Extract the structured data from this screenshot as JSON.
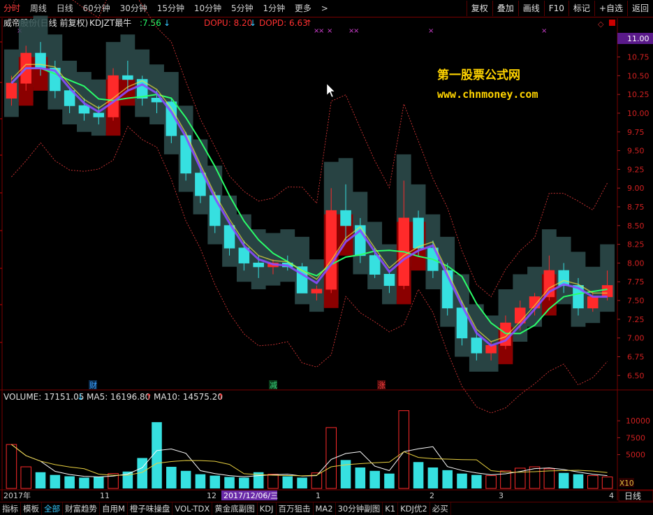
{
  "toolbar": {
    "timeframes": [
      "分时",
      "周线",
      "日线",
      "60分钟",
      "30分钟",
      "15分钟",
      "10分钟",
      "5分钟",
      "1分钟",
      "更多"
    ],
    "more_arrow": ">",
    "right_buttons": [
      "复权",
      "叠加",
      "画线",
      "F10",
      "标记",
      "+自选",
      "返回"
    ]
  },
  "main_panel": {
    "stock_title": "威帝股份(日线 前复权)",
    "indicator_name": "KDJZT最牛",
    "indicator_value": ":7.56",
    "indicator_arrow": "↓",
    "dopu_label": "DOPU: 8.20",
    "dopu_arrow": "↓",
    "dopd_label": "DOPD: 6.63",
    "dopd_arrow": "↑",
    "watermark_title": "第一股票公式网",
    "watermark_url": "www.chnmoney.com",
    "current_price_tag": "11.00",
    "price_axis": [
      "10.75",
      "10.50",
      "10.25",
      "10.00",
      "9.75",
      "9.50",
      "9.25",
      "9.00",
      "8.75",
      "8.50",
      "8.25",
      "8.00",
      "7.75",
      "7.50",
      "7.25",
      "7.00",
      "6.75",
      "6.50"
    ],
    "event_markers": [
      {
        "label": "财",
        "color": "#3aa0ff"
      },
      {
        "label": "减",
        "color": "#39d27b"
      },
      {
        "label": "涨",
        "color": "#ff4040"
      }
    ],
    "colors": {
      "up": "#ff2a2a",
      "down": "#36e0e0",
      "band": "#2f4f4f",
      "fill_red": "#8b0000",
      "ma_green": "#2aff6a",
      "purple": "#8a4dff",
      "yellow": "#e8e040",
      "dotted": "#c03030"
    }
  },
  "volume_panel": {
    "volume_label": "VOLUME: 17151.05",
    "volume_arrow": "↓",
    "ma5_label": "MA5: 16196.80",
    "ma5_arrow": "↑",
    "ma10_label": "MA10: 14575.20",
    "ma10_arrow": "↑",
    "axis": [
      "10000",
      "7500",
      "5000"
    ],
    "unit": "X10"
  },
  "date_axis": {
    "labels": [
      "2017年",
      "11",
      "12",
      "1",
      "2",
      "3",
      "4"
    ],
    "cursor_date": "2017/12/06/三",
    "period": "日线"
  },
  "bottom_tabs": [
    "指标",
    "模板",
    "全部",
    "财富趋势",
    "自用M",
    "橙子味操盘",
    "VOL-TDX",
    "黄金底副图",
    "KDJ",
    "百万狙击",
    "MA2",
    "30分钟副图",
    "K1",
    "KDJ优2",
    "必买"
  ],
  "active_bottom_tab": "全部",
  "chart_data": {
    "type": "candlestick",
    "title": "威帝股份(日线 前复权)",
    "ylim": [
      6.4,
      11.1
    ],
    "candles_ohlc": [
      [
        10.2,
        10.5,
        10.1,
        10.4
      ],
      [
        10.4,
        10.9,
        10.3,
        10.8
      ],
      [
        10.8,
        10.95,
        10.5,
        10.6
      ],
      [
        10.6,
        10.7,
        10.2,
        10.3
      ],
      [
        10.3,
        10.35,
        10.0,
        10.1
      ],
      [
        10.1,
        10.2,
        9.9,
        10.0
      ],
      [
        10.0,
        10.1,
        9.85,
        9.95
      ],
      [
        9.95,
        10.6,
        9.9,
        10.5
      ],
      [
        10.5,
        10.7,
        10.3,
        10.45
      ],
      [
        10.45,
        10.5,
        10.1,
        10.2
      ],
      [
        10.2,
        10.3,
        10.0,
        10.15
      ],
      [
        10.15,
        10.2,
        9.6,
        9.7
      ],
      [
        9.7,
        9.75,
        9.1,
        9.2
      ],
      [
        9.2,
        9.3,
        8.8,
        8.9
      ],
      [
        8.9,
        8.95,
        8.4,
        8.5
      ],
      [
        8.5,
        8.55,
        8.1,
        8.2
      ],
      [
        8.2,
        8.3,
        7.9,
        8.0
      ],
      [
        8.0,
        8.1,
        7.8,
        7.95
      ],
      [
        7.95,
        8.05,
        7.85,
        8.0
      ],
      [
        8.0,
        8.1,
        7.9,
        7.95
      ],
      [
        7.95,
        8.0,
        7.7,
        7.6
      ],
      [
        7.6,
        7.7,
        7.5,
        7.65
      ],
      [
        7.65,
        9.0,
        7.6,
        8.7
      ],
      [
        8.7,
        9.05,
        8.3,
        8.5
      ],
      [
        8.5,
        8.6,
        8.0,
        8.1
      ],
      [
        8.1,
        8.2,
        7.8,
        7.85
      ],
      [
        7.85,
        7.9,
        7.6,
        7.7
      ],
      [
        7.7,
        9.1,
        7.65,
        8.6
      ],
      [
        8.6,
        8.7,
        8.1,
        8.2
      ],
      [
        8.2,
        8.3,
        7.8,
        7.9
      ],
      [
        7.9,
        8.0,
        7.3,
        7.4
      ],
      [
        7.4,
        7.5,
        6.9,
        7.0
      ],
      [
        7.0,
        7.1,
        6.7,
        6.8
      ],
      [
        6.8,
        6.95,
        6.7,
        6.9
      ],
      [
        6.9,
        7.3,
        6.85,
        7.2
      ],
      [
        7.2,
        7.5,
        7.1,
        7.4
      ],
      [
        7.4,
        7.6,
        7.3,
        7.55
      ],
      [
        7.55,
        8.1,
        7.5,
        7.9
      ],
      [
        7.9,
        8.0,
        7.6,
        7.7
      ],
      [
        7.7,
        7.8,
        7.3,
        7.4
      ],
      [
        7.4,
        7.6,
        7.35,
        7.55
      ],
      [
        7.55,
        7.9,
        7.5,
        7.7
      ]
    ],
    "volume": [
      6500,
      3200,
      2400,
      2000,
      1800,
      1600,
      1700,
      2200,
      2500,
      4500,
      9800,
      3200,
      2600,
      2100,
      1900,
      1700,
      1600,
      2400,
      2100,
      1800,
      1600,
      2300,
      9000,
      4200,
      3100,
      2600,
      2200,
      11500,
      3900,
      3100,
      2700,
      2200,
      2000,
      1900,
      2600,
      3000,
      3200,
      2900,
      2300,
      2100,
      1900,
      1700
    ]
  }
}
